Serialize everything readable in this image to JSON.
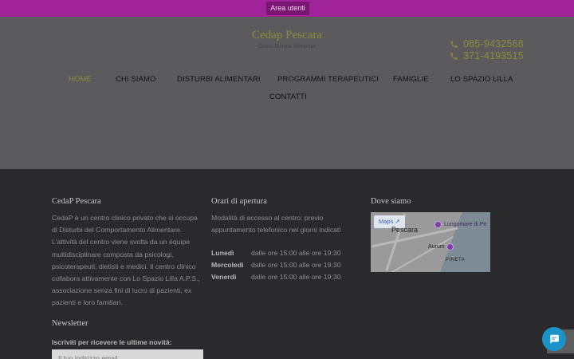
{
  "topbar": {
    "area_utenti": "Area utenti"
  },
  "header": {
    "logo_title": "Cedap Pescara",
    "logo_subtitle": "Centro Disturbi Alimentari",
    "phones": [
      "085-9432568",
      "371-4193515"
    ]
  },
  "nav": {
    "items": [
      "HOME",
      "CHI SIAMO",
      "DISTURBI ALIMENTARI",
      "PROGRAMMI TERAPEUTICI",
      "FAMIGLIE",
      "LO SPAZIO LILLA",
      "CONTATTI"
    ]
  },
  "footer": {
    "about": {
      "title": "CedaP Pescara",
      "lines": [
        "CedaP è un centro clinico privato che si occupa",
        "di Disturbi del Comportamento Alimentare.",
        "L'attività del centro viene svolta da un équipe",
        "multidisciplinare composta da psicologi,",
        "psicoterapeuti, dietisti e medici. Il centro clinico",
        "collabora attivamente con Lo Spazio Lilla A.P.S.,",
        "associazione senza fini di lucro di pazienti, ex",
        "pazienti e loro familiari."
      ]
    },
    "hours": {
      "title": "Orari di apertura",
      "intro_lines": [
        "Modalità di accesso al centro: previo",
        "appuntamento telefonico nei giorni indicati"
      ],
      "rows": [
        {
          "day": "Lunedì",
          "time": "dalle ore 15:00 alle ore 19:30"
        },
        {
          "day": "Mercoledì",
          "time": "dalle ore 15:00 alle ore 19:30"
        },
        {
          "day": "Venerdì",
          "time": "dalle ore 15:00 alle ore 19:30"
        }
      ]
    },
    "location": {
      "title": "Dove siamo",
      "maps_label": "Maps",
      "map_labels": [
        "Pescara",
        "Lungomare di Pe",
        "Aurum",
        "PINETA"
      ]
    },
    "newsletter": {
      "title": "Newsletter",
      "label": "Iscriviti per ricevere le ultime novità:",
      "placeholder": "Il tuo indirizzo email"
    }
  },
  "colors": {
    "topbar": "#a0239a",
    "accent": "#8a8a3a",
    "chat": "#1a93c9"
  }
}
